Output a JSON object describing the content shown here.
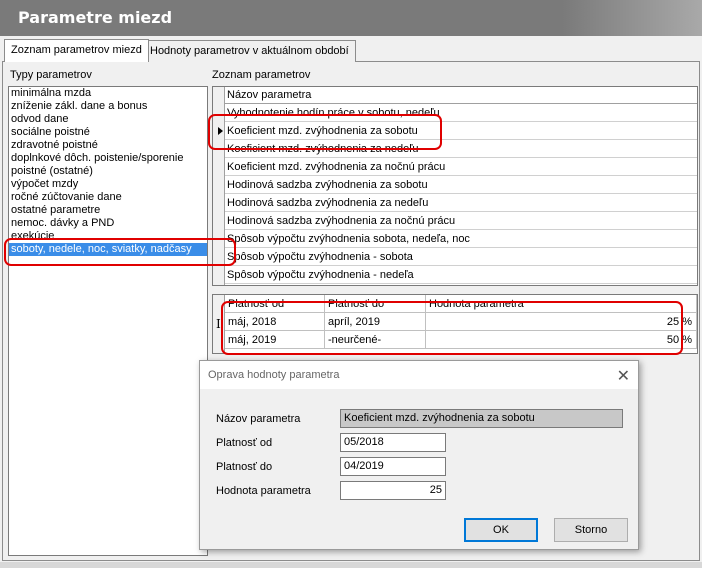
{
  "window": {
    "title": "Parametre miezd"
  },
  "tabs": [
    {
      "label": "Zoznam parametrov miezd",
      "active": true
    },
    {
      "label": "Hodnoty parametrov v aktuálnom období",
      "active": false
    }
  ],
  "types_panel": {
    "label": "Typy parametrov",
    "items": [
      "minimálna mzda",
      "zníženie zákl. dane a bonus",
      "odvod dane",
      "sociálne poistné",
      "zdravotné poistné",
      "doplnkové dôch. poistenie/sporenie",
      "poistné (ostatné)",
      "výpočet mzdy",
      "ročné zúčtovanie dane",
      "ostatné parametre",
      "nemoc. dávky a PND",
      "exekúcie",
      "soboty, nedele, noc, sviatky, nadčasy"
    ],
    "selected_index": 12
  },
  "params_panel": {
    "label": "Zoznam parametrov",
    "column_header": "Názov parametra",
    "rows": [
      "Vyhodnotenie hodín práce v sobotu, nedeľu",
      "Koeficient mzd. zvýhodnenia za sobotu",
      "Koeficient mzd. zvýhodnenia za nedeľu",
      "Koeficient mzd. zvýhodnenia za nočnú prácu",
      "Hodinová sadzba zvýhodnenia za sobotu",
      "Hodinová sadzba zvýhodnenia za nedeľu",
      "Hodinová sadzba zvýhodnenia za nočnú prácu",
      "Spôsob výpočtu zvýhodnenia sobota, nedeľa, noc",
      "Spôsob výpočtu zvýhodnenia - sobota",
      "Spôsob výpočtu zvýhodnenia - nedeľa"
    ],
    "current_index": 1
  },
  "values_grid": {
    "headers": [
      "Platnosť od",
      "Platnosť do",
      "Hodnota parametra"
    ],
    "rows": [
      {
        "from": "máj, 2018",
        "to": "apríl, 2019",
        "value": "25 %"
      },
      {
        "from": "máj, 2019",
        "to": "-neurčené-",
        "value": "50 %"
      }
    ]
  },
  "dialog": {
    "title": "Oprava hodnoty parametra",
    "name_label": "Názov parametra",
    "name_value": "Koeficient mzd. zvýhodnenia za sobotu",
    "from_label": "Platnosť od",
    "from_value": "05/2018",
    "to_label": "Platnosť do",
    "to_value": "04/2019",
    "value_label": "Hodnota parametra",
    "value_value": "25",
    "ok_label": "OK",
    "cancel_label": "Storno"
  },
  "colors": {
    "highlight": "#e00000",
    "selection": "#3a8de8",
    "title_bar": "#7a7a7a"
  }
}
